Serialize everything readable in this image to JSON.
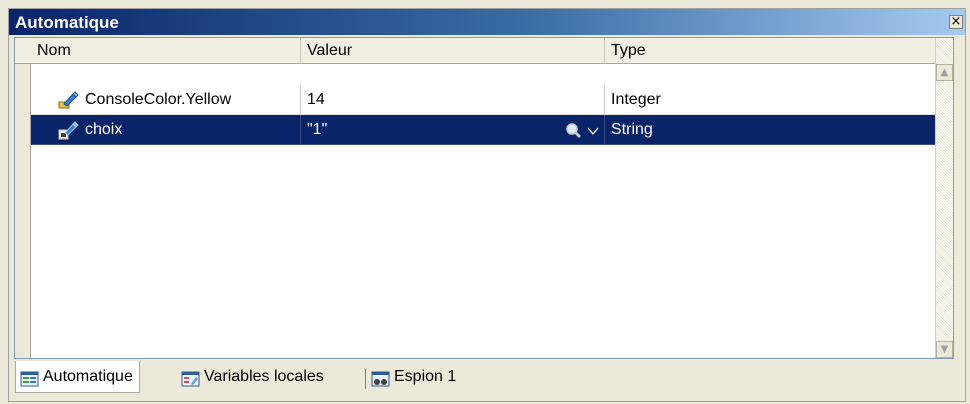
{
  "window": {
    "title": "Automatique",
    "close_glyph": "×"
  },
  "columns": {
    "name": "Nom",
    "value": "Valeur",
    "type": "Type"
  },
  "rows": [
    {
      "name": "ConsoleColor.Yellow",
      "value": "14",
      "type": "Integer",
      "icon": "property-icon",
      "selected": false
    },
    {
      "name": "choix",
      "value": "\"1\"",
      "type": "String",
      "icon": "local-variable-icon",
      "selected": true
    }
  ],
  "scrollbar": {
    "up_glyph": "▲",
    "down_glyph": "▼"
  },
  "tabs": [
    {
      "label": "Automatique",
      "icon": "autos-window-icon",
      "active": true
    },
    {
      "label": "Variables locales",
      "icon": "locals-window-icon",
      "active": false
    },
    {
      "label": "Espion 1",
      "icon": "watch-window-icon",
      "active": false
    }
  ],
  "colors": {
    "selection": "#0a246a",
    "title_gradient_start": "#0a246a",
    "title_gradient_end": "#a6caf0"
  }
}
